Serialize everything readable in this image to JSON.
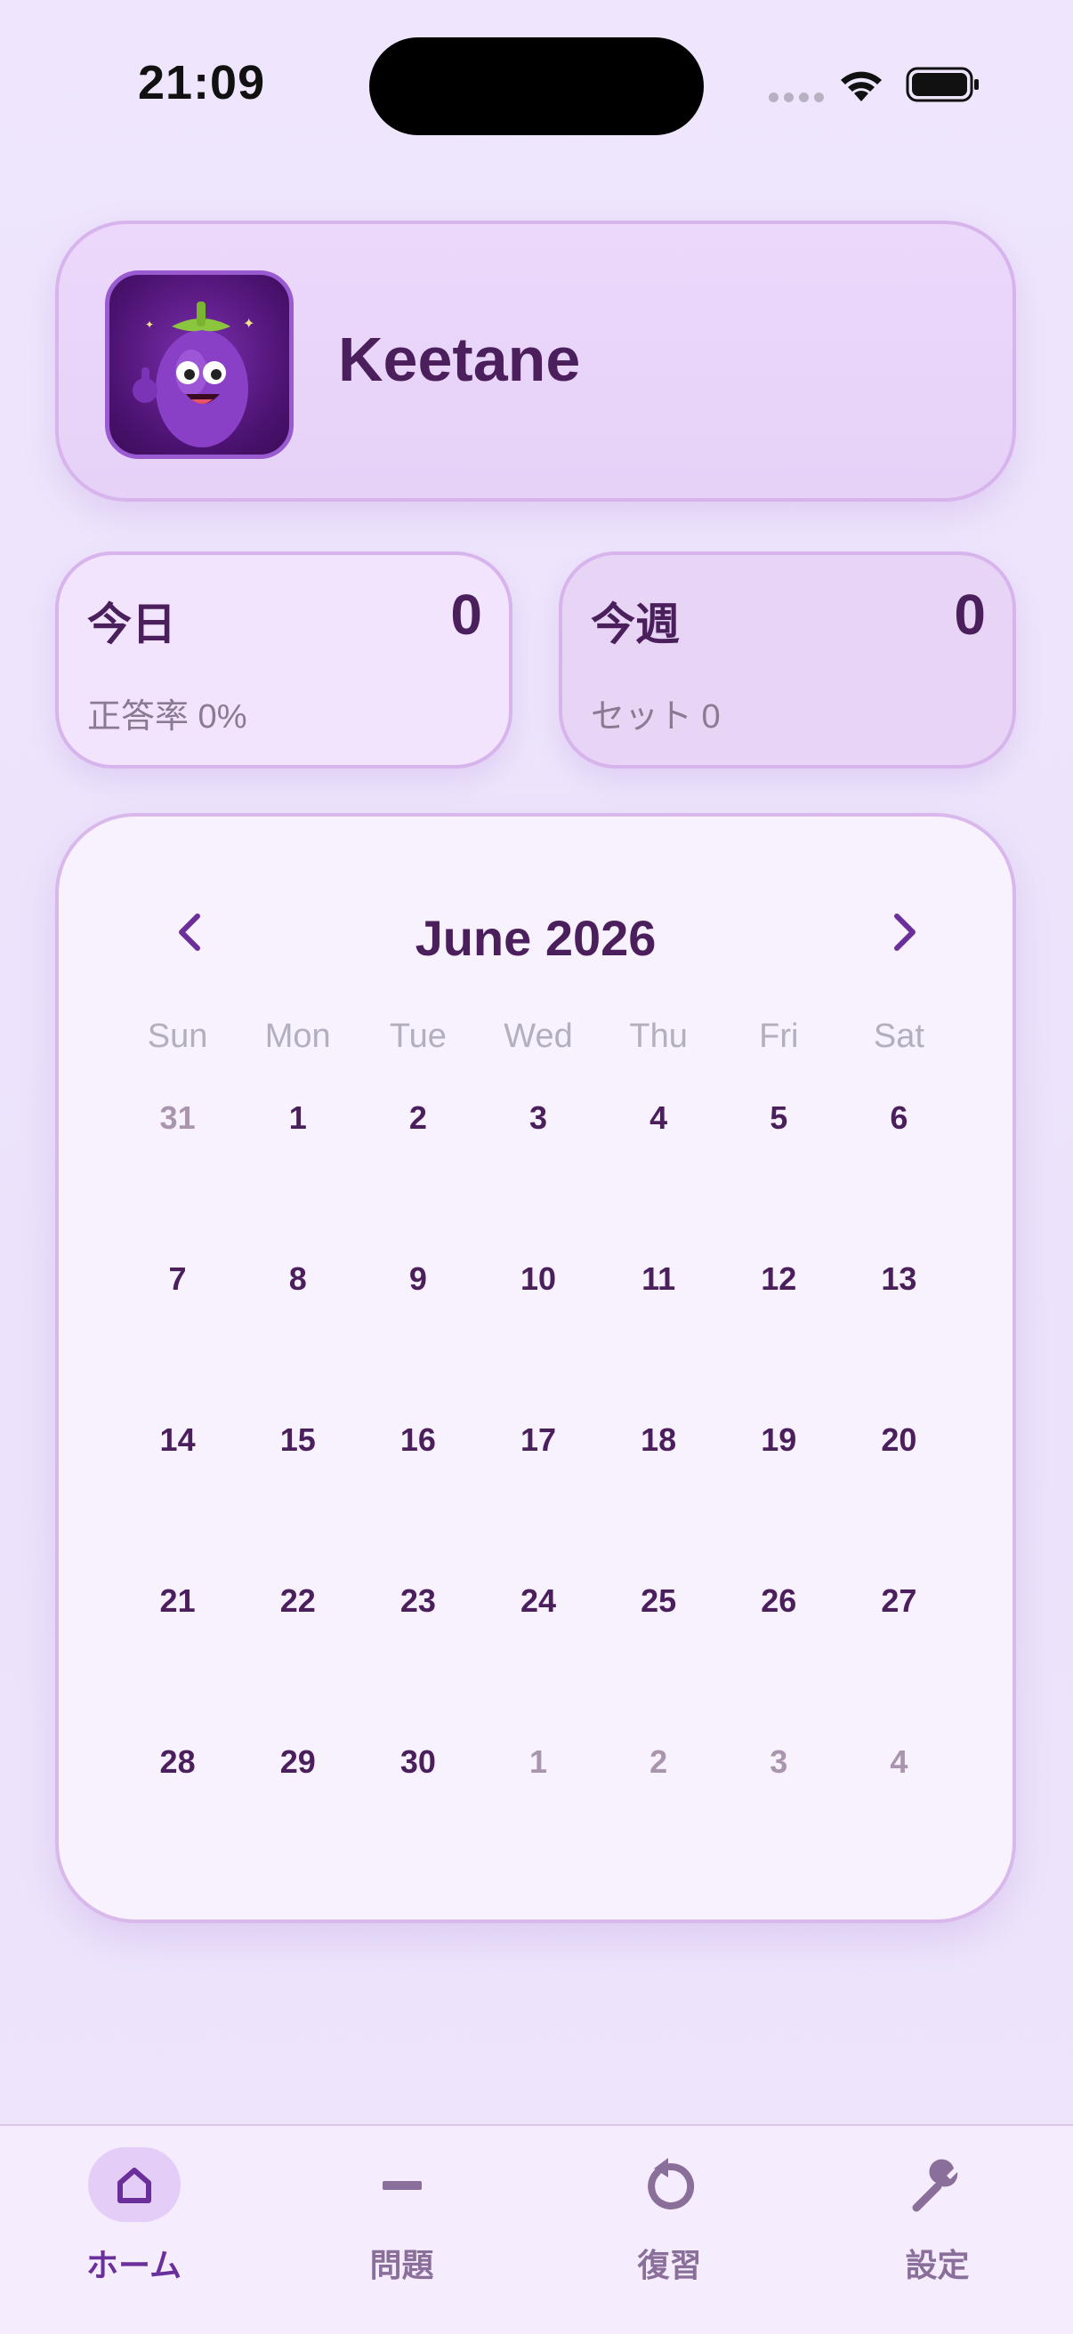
{
  "status_bar": {
    "time": "21:09"
  },
  "profile": {
    "name": "Keetane"
  },
  "stats": {
    "today": {
      "label": "今日",
      "value": "0",
      "sub": "正答率 0%"
    },
    "week": {
      "label": "今週",
      "value": "0",
      "sub": "セット 0"
    }
  },
  "calendar": {
    "title": "June 2026",
    "weekdays": [
      "Sun",
      "Mon",
      "Tue",
      "Wed",
      "Thu",
      "Fri",
      "Sat"
    ],
    "days": [
      {
        "d": "31",
        "muted": true
      },
      {
        "d": "1"
      },
      {
        "d": "2"
      },
      {
        "d": "3"
      },
      {
        "d": "4"
      },
      {
        "d": "5"
      },
      {
        "d": "6"
      },
      {
        "d": "7"
      },
      {
        "d": "8"
      },
      {
        "d": "9"
      },
      {
        "d": "10"
      },
      {
        "d": "11"
      },
      {
        "d": "12"
      },
      {
        "d": "13"
      },
      {
        "d": "14"
      },
      {
        "d": "15"
      },
      {
        "d": "16"
      },
      {
        "d": "17"
      },
      {
        "d": "18"
      },
      {
        "d": "19"
      },
      {
        "d": "20"
      },
      {
        "d": "21"
      },
      {
        "d": "22"
      },
      {
        "d": "23"
      },
      {
        "d": "24"
      },
      {
        "d": "25"
      },
      {
        "d": "26"
      },
      {
        "d": "27"
      },
      {
        "d": "28"
      },
      {
        "d": "29"
      },
      {
        "d": "30"
      },
      {
        "d": "1",
        "muted": true
      },
      {
        "d": "2",
        "muted": true
      },
      {
        "d": "3",
        "muted": true
      },
      {
        "d": "4",
        "muted": true
      }
    ]
  },
  "tabs": [
    {
      "label": "ホーム",
      "icon": "home-icon",
      "active": true
    },
    {
      "label": "問題",
      "icon": "minus-icon",
      "active": false
    },
    {
      "label": "復習",
      "icon": "refresh-icon",
      "active": false
    },
    {
      "label": "設定",
      "icon": "wrench-icon",
      "active": false
    }
  ],
  "colors": {
    "accent": "#6b2f9b",
    "text": "#4a1f5c",
    "muted": "#a995ad"
  }
}
